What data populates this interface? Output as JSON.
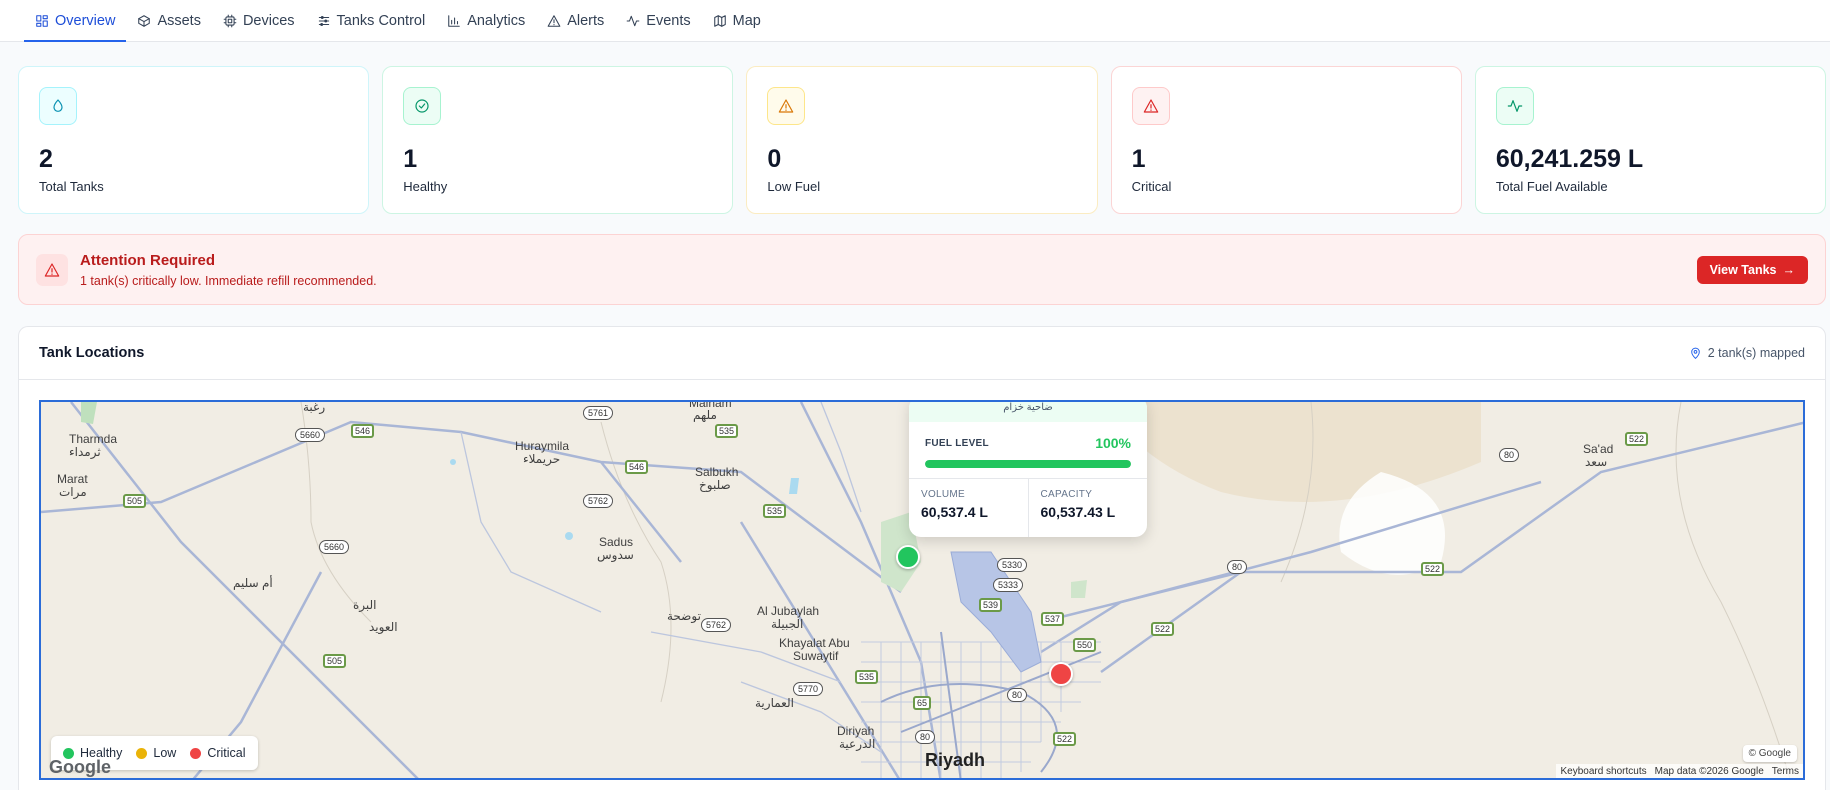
{
  "nav": {
    "tabs": [
      {
        "label": "Overview",
        "icon": "layout-grid-icon",
        "active": true
      },
      {
        "label": "Assets",
        "icon": "box-icon"
      },
      {
        "label": "Devices",
        "icon": "cpu-icon"
      },
      {
        "label": "Tanks Control",
        "icon": "sliders-icon"
      },
      {
        "label": "Analytics",
        "icon": "bar-chart-icon"
      },
      {
        "label": "Alerts",
        "icon": "alert-triangle-icon"
      },
      {
        "label": "Events",
        "icon": "activity-icon"
      },
      {
        "label": "Map",
        "icon": "map-icon"
      }
    ]
  },
  "stats": {
    "total_tanks": {
      "value": "2",
      "label": "Total Tanks",
      "icon": "droplet-icon"
    },
    "healthy": {
      "value": "1",
      "label": "Healthy",
      "icon": "check-circle-icon"
    },
    "low_fuel": {
      "value": "0",
      "label": "Low Fuel",
      "icon": "alert-triangle-icon"
    },
    "critical": {
      "value": "1",
      "label": "Critical",
      "icon": "alert-triangle-icon"
    },
    "total_fuel": {
      "value": "60,241.259 L",
      "label": "Total Fuel Available",
      "icon": "activity-icon"
    }
  },
  "alert": {
    "title": "Attention Required",
    "message": "1 tank(s) critically low. Immediate refill recommended.",
    "button_label": "View Tanks"
  },
  "map_panel": {
    "title": "Tank Locations",
    "mapped_text": "2 tank(s) mapped",
    "legend": [
      {
        "label": "Healthy",
        "color": "#22c55e"
      },
      {
        "label": "Low",
        "color": "#eab308"
      },
      {
        "label": "Critical",
        "color": "#ef4444"
      }
    ],
    "popup": {
      "header": "ضاحية خزام",
      "fuel_level_label": "FUEL LEVEL",
      "fuel_level_pct": "100%",
      "fuel_level_fraction": 1.0,
      "volume_label": "VOLUME",
      "volume_value": "60,537.4 L",
      "capacity_label": "CAPACITY",
      "capacity_value": "60,537.43 L"
    },
    "places": {
      "thaduq": "رغبة",
      "tharmda": "Tharmda",
      "tharmda_ar": "ثرمداء",
      "marat": "Marat",
      "marat_ar": "مرات",
      "huraymila": "Huraymila",
      "huraymila_ar": "حريملاء",
      "malham": "Malham",
      "malham_ar": "ملهم",
      "salbukh": "Salbukh",
      "salbukh_ar": "صلبوخ",
      "sadus": "Sadus",
      "sadus_ar": "سدوس",
      "um_sulaym": "أم سليم",
      "albirrah": "البرة",
      "aluwaid": "العويد",
      "tawdiha": "توضحة",
      "jubaylah": "Al Jubaylah",
      "jubaylah_ar": "الجبيلة",
      "khayalat1": "Khayalat Abu",
      "khayalat2": "Suwaytif",
      "ammariyah": "العمارية",
      "diriyah": "Diriyah",
      "diriyah_ar": "الدرعية",
      "riyadh": "Riyadh",
      "saad": "Sa'ad",
      "saad_ar": "سعد"
    },
    "roads": [
      "505",
      "505",
      "546",
      "5660",
      "5660",
      "5761",
      "535",
      "535",
      "546",
      "5762",
      "535",
      "5762",
      "5770",
      "535",
      "65",
      "80",
      "5330",
      "5333",
      "539",
      "537",
      "550",
      "80",
      "522",
      "522",
      "80",
      "80",
      "522",
      "522"
    ],
    "attribution": {
      "keyboard": "Keyboard shortcuts",
      "mapdata": "Map data ©2026 Google",
      "terms": "Terms",
      "copyright": "© Google",
      "watermark": "Google"
    }
  }
}
